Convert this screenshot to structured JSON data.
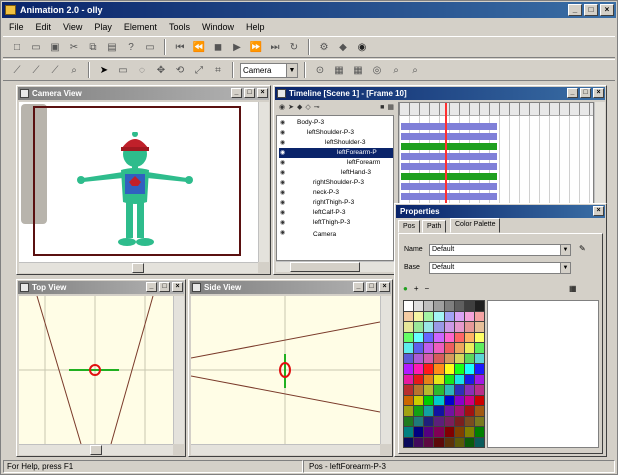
{
  "app": {
    "title": "Animation 2.0 - olly",
    "window_controls": [
      "_",
      "□",
      "×"
    ]
  },
  "menubar": [
    "File",
    "Edit",
    "View",
    "Play",
    "Element",
    "Tools",
    "Window",
    "Help"
  ],
  "toolbar2": {
    "camera_select": "Camera"
  },
  "panes": {
    "camera": {
      "title": "Camera View"
    },
    "timeline": {
      "title": "Timeline [Scene 1] - [Frame 10]"
    },
    "top": {
      "title": "Top View"
    },
    "side": {
      "title": "Side View"
    },
    "properties": {
      "title": "Properties"
    }
  },
  "timeline_tree": [
    "Body-P-3",
    "leftShoulder-P-3",
    "leftShoulder-3",
    "leftForearm-P",
    "leftForearm",
    "leftHand-3",
    "rightShoulder-P-3",
    "neck-P-3",
    "rightThigh-P-3",
    "leftCalf-P-3",
    "leftThigh-P-3",
    "Camera"
  ],
  "timeline_selected_index": 3,
  "properties": {
    "tabs": [
      "Pos",
      "Path",
      "Color Palette"
    ],
    "active_tab": 2,
    "name_label": "Name",
    "name_value": "Default",
    "base_label": "Base",
    "base_value": "Default"
  },
  "colors": {
    "titlebar_active": "#0a246a",
    "timeline_playhead": "#ff3030",
    "figure_body": "#2ebc8c",
    "figure_head_cap": "#c0202a",
    "view_background": "#fffde6",
    "track_blue": "#8080d8",
    "track_green": "#20a020"
  },
  "icons": [
    "app-icon",
    "eye-icon",
    "arrow-icon",
    "lock-icon",
    "camera-icon"
  ],
  "status": {
    "help": "For Help, press F1",
    "selection": "Pos - leftForearm-P-3"
  }
}
